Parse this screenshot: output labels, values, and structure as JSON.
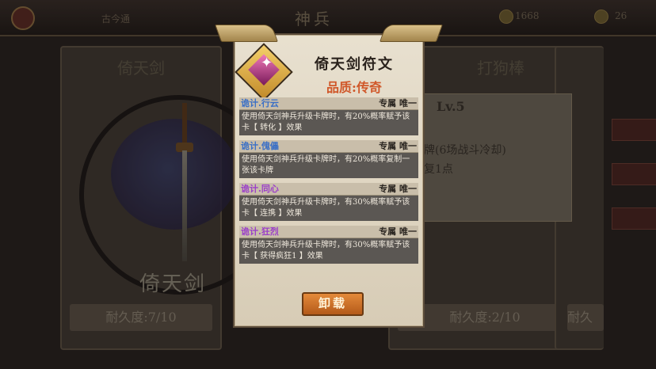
{
  "topbar": {
    "user": "古今通",
    "title": "神兵",
    "currency1": "1668",
    "currency2": "26"
  },
  "background": {
    "panel_left": {
      "name": "倚天剑",
      "art_name": "倚天剑",
      "durability": "耐久度:7/10"
    },
    "panel_right": {
      "name": "打狗棒",
      "durability": "耐久度:2/10",
      "level": "Lv.5",
      "line1": "牌(6场战斗冷却)",
      "line2": "复1点"
    },
    "panel_edge": {
      "durability": "耐久"
    }
  },
  "modal": {
    "title": "倚天剑符文",
    "quality": "品质:传奇",
    "icon": "rune-diamond-icon",
    "effects": [
      {
        "name": "诡计.行云",
        "tag": "专属 唯一",
        "color": "blue",
        "desc": "使用倚天剑神兵升级卡牌时，有20%概率赋予该卡【 转化 】效果"
      },
      {
        "name": "诡计.傀儡",
        "tag": "专属 唯一",
        "color": "blue",
        "desc": "使用倚天剑神兵升级卡牌时，有20%概率复制一张该卡牌"
      },
      {
        "name": "诡计.同心",
        "tag": "专属 唯一",
        "color": "purple",
        "desc": "使用倚天剑神兵升级卡牌时，有30%概率赋予该卡【 连携 】效果"
      },
      {
        "name": "诡计.狂烈",
        "tag": "专属 唯一",
        "color": "purple",
        "desc": "使用倚天剑神兵升级卡牌时，有30%概率赋予该卡【 获得疯狂1 】效果"
      }
    ],
    "unload_label": "卸载"
  }
}
